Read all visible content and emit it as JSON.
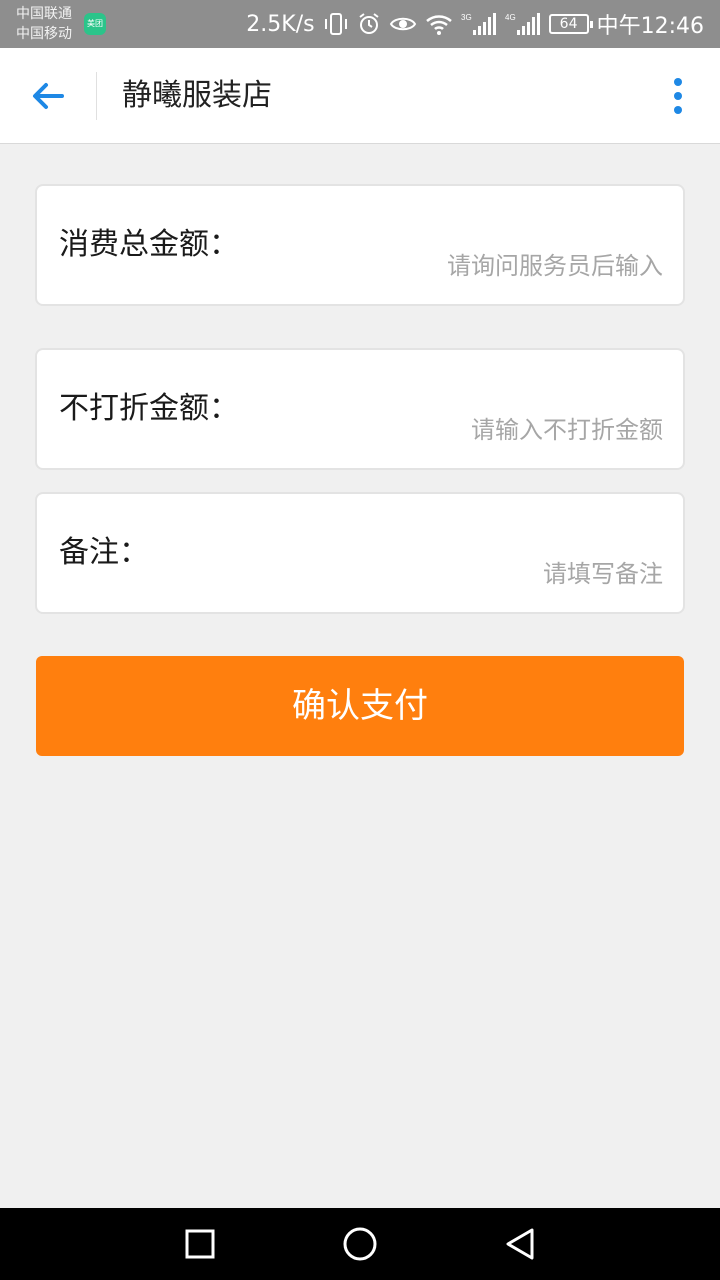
{
  "status_bar": {
    "carrier_1": "中国联通",
    "carrier_2": "中国移动",
    "app_badge": "美团",
    "net_speed": "2.5K/s",
    "signal_3g": "3G",
    "signal_4g": "4G",
    "battery": "64",
    "time": "中午12:46"
  },
  "header": {
    "title": "静曦服装店",
    "back_icon": "arrow-left-icon",
    "more_icon": "more-vertical-icon",
    "accent": "#1e88e5"
  },
  "form": {
    "total": {
      "label": "消费总金额：",
      "placeholder": "请询问服务员后输入"
    },
    "no_discount": {
      "label": "不打折金额：",
      "placeholder": "请输入不打折金额"
    },
    "note": {
      "label": "备注：",
      "placeholder": "请填写备注"
    }
  },
  "actions": {
    "confirm_label": "确认支付",
    "confirm_color": "#ff7f0e"
  },
  "nav_bar": {
    "recents_icon": "square-icon",
    "home_icon": "circle-icon",
    "back_icon": "triangle-back-icon"
  }
}
